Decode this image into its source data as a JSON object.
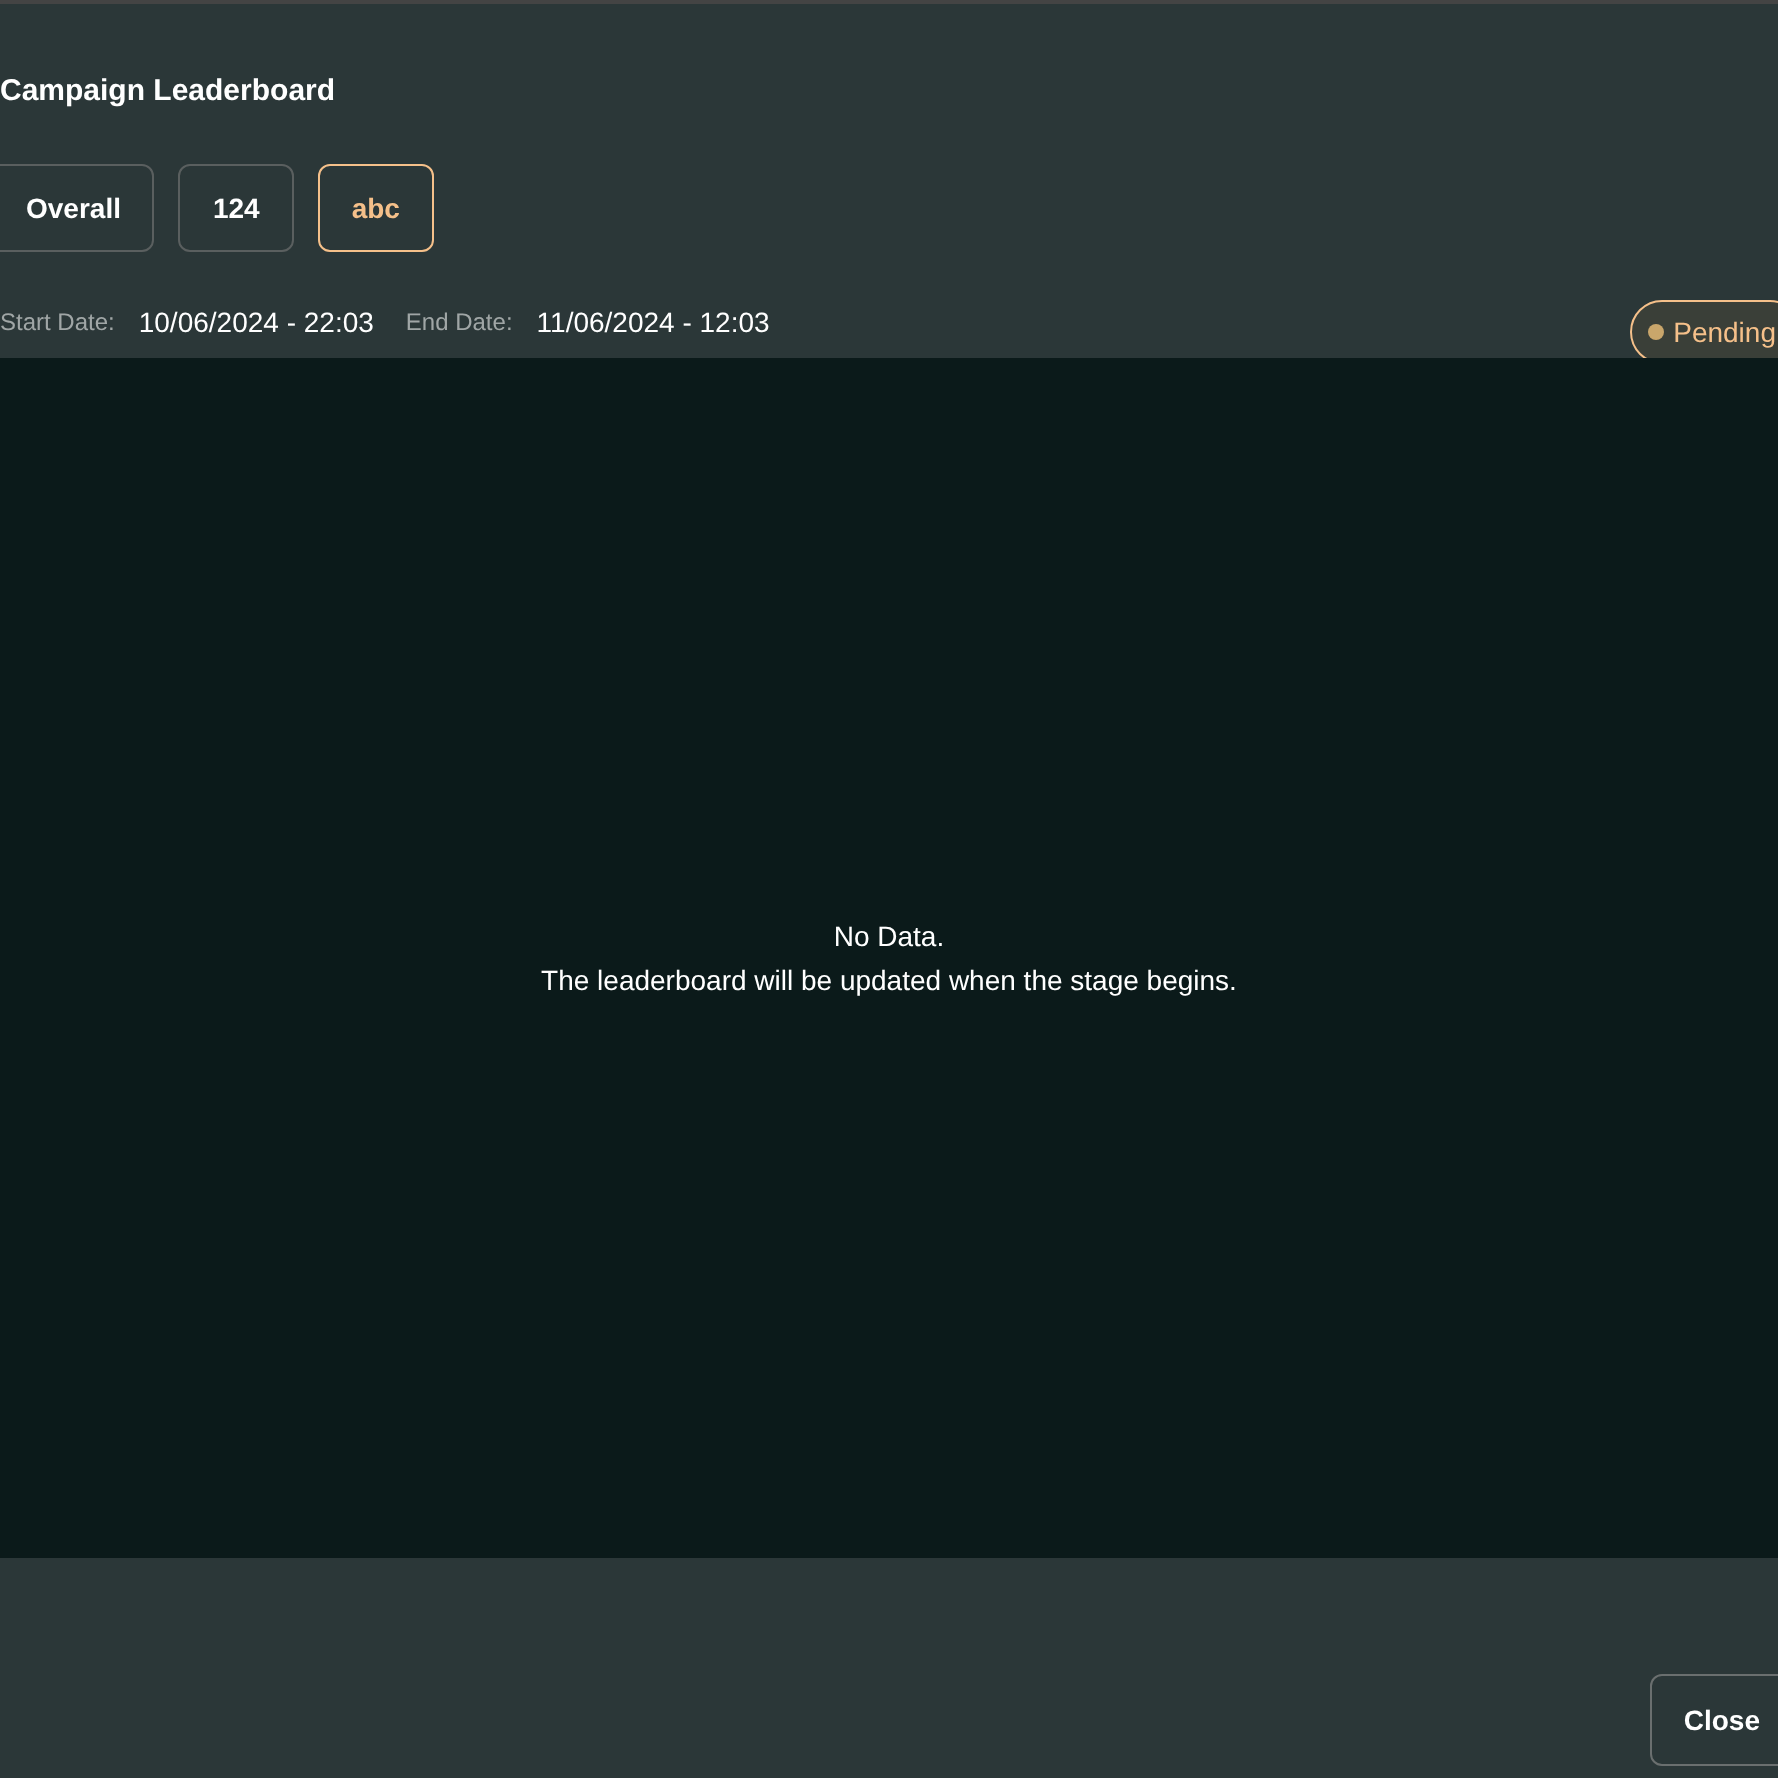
{
  "dialog": {
    "title": "Campaign Leaderboard"
  },
  "tabs": [
    {
      "label": "Overall",
      "selected": false
    },
    {
      "label": "124",
      "selected": false
    },
    {
      "label": "abc",
      "selected": true
    }
  ],
  "dates": [
    {
      "label": "Start Date:",
      "value": "10/06/2024 - 22:03"
    },
    {
      "label": "End Date:",
      "value": "11/06/2024 - 12:03"
    }
  ],
  "status": {
    "label": "Pending",
    "color": "#c9a66b"
  },
  "empty_state": {
    "lines": [
      "No Data.",
      "The leaderboard will be updated when the stage begins."
    ]
  },
  "buttons": [
    {
      "label": "Close"
    }
  ]
}
